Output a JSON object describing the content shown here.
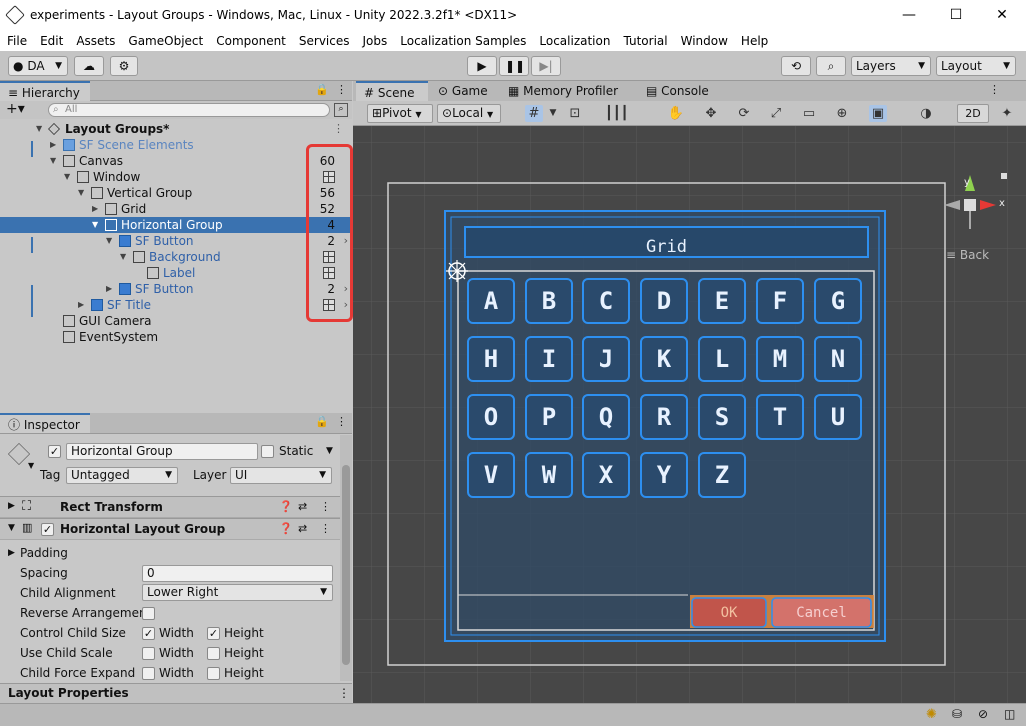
{
  "window": {
    "title": "experiments - Layout Groups - Windows, Mac, Linux - Unity 2022.3.2f1* <DX11>",
    "minimize": "—",
    "maximize": "☐",
    "close": "✕"
  },
  "menu": [
    "File",
    "Edit",
    "Assets",
    "GameObject",
    "Component",
    "Services",
    "Jobs",
    "Localization Samples",
    "Localization",
    "Tutorial",
    "Window",
    "Help"
  ],
  "toolbar": {
    "account": "DA",
    "layers": "Layers",
    "layout": "Layout"
  },
  "hierarchy": {
    "tab": "Hierarchy",
    "search_placeholder": "All",
    "rows": [
      {
        "label": "Layout Groups*",
        "count": "",
        "bold": true
      },
      {
        "label": "SF Scene Elements",
        "count": "",
        "blue": true
      },
      {
        "label": "Canvas",
        "count": "60"
      },
      {
        "label": "Window",
        "count": ""
      },
      {
        "label": "Vertical Group",
        "count": "56"
      },
      {
        "label": "Grid",
        "count": "52"
      },
      {
        "label": "Horizontal Group",
        "count": "4",
        "selected": true
      },
      {
        "label": "SF Button",
        "count": "2",
        "blue": true
      },
      {
        "label": "Background",
        "count": "",
        "blue": true
      },
      {
        "label": "Label",
        "count": "",
        "blue": true
      },
      {
        "label": "SF Button",
        "count": "2",
        "blue": true
      },
      {
        "label": "SF Title",
        "count": "",
        "blue": true
      },
      {
        "label": "GUI Camera",
        "count": ""
      },
      {
        "label": "EventSystem",
        "count": ""
      }
    ]
  },
  "inspector": {
    "tab": "Inspector",
    "object_name": "Horizontal Group",
    "static_label": "Static",
    "tag_label": "Tag",
    "tag_value": "Untagged",
    "layer_label": "Layer",
    "layer_value": "UI",
    "components": [
      "Rect Transform",
      "Horizontal Layout Group"
    ],
    "props": {
      "padding": "Padding",
      "spacing": "Spacing",
      "spacing_value": "0",
      "child_alignment": "Child Alignment",
      "child_alignment_value": "Lower Right",
      "reverse": "Reverse Arrangement",
      "control_child_size": "Control Child Size",
      "use_child_scale": "Use Child Scale",
      "child_force_expand": "Child Force Expand",
      "width": "Width",
      "height": "Height"
    },
    "footer": "Layout Properties"
  },
  "scene": {
    "tabs": [
      "Scene",
      "Game",
      "Memory Profiler",
      "Console"
    ],
    "pivot": "Pivot",
    "local": "Local",
    "twod": "2D",
    "back_label": "Back",
    "gizmo": {
      "y": "y",
      "x": "x"
    },
    "title": "Grid",
    "keys": [
      "A",
      "B",
      "C",
      "D",
      "E",
      "F",
      "G",
      "H",
      "I",
      "J",
      "K",
      "L",
      "M",
      "N",
      "O",
      "P",
      "Q",
      "R",
      "S",
      "T",
      "U",
      "V",
      "W",
      "X",
      "Y",
      "Z"
    ],
    "ok": "OK",
    "cancel": "Cancel"
  },
  "colors": {
    "selection": "#3a72b0",
    "highlight_box": "#e53935",
    "ui_blue": "#2d8ff0",
    "ok_red": "#c0504d",
    "cancel_orange": "#e08a3c"
  }
}
